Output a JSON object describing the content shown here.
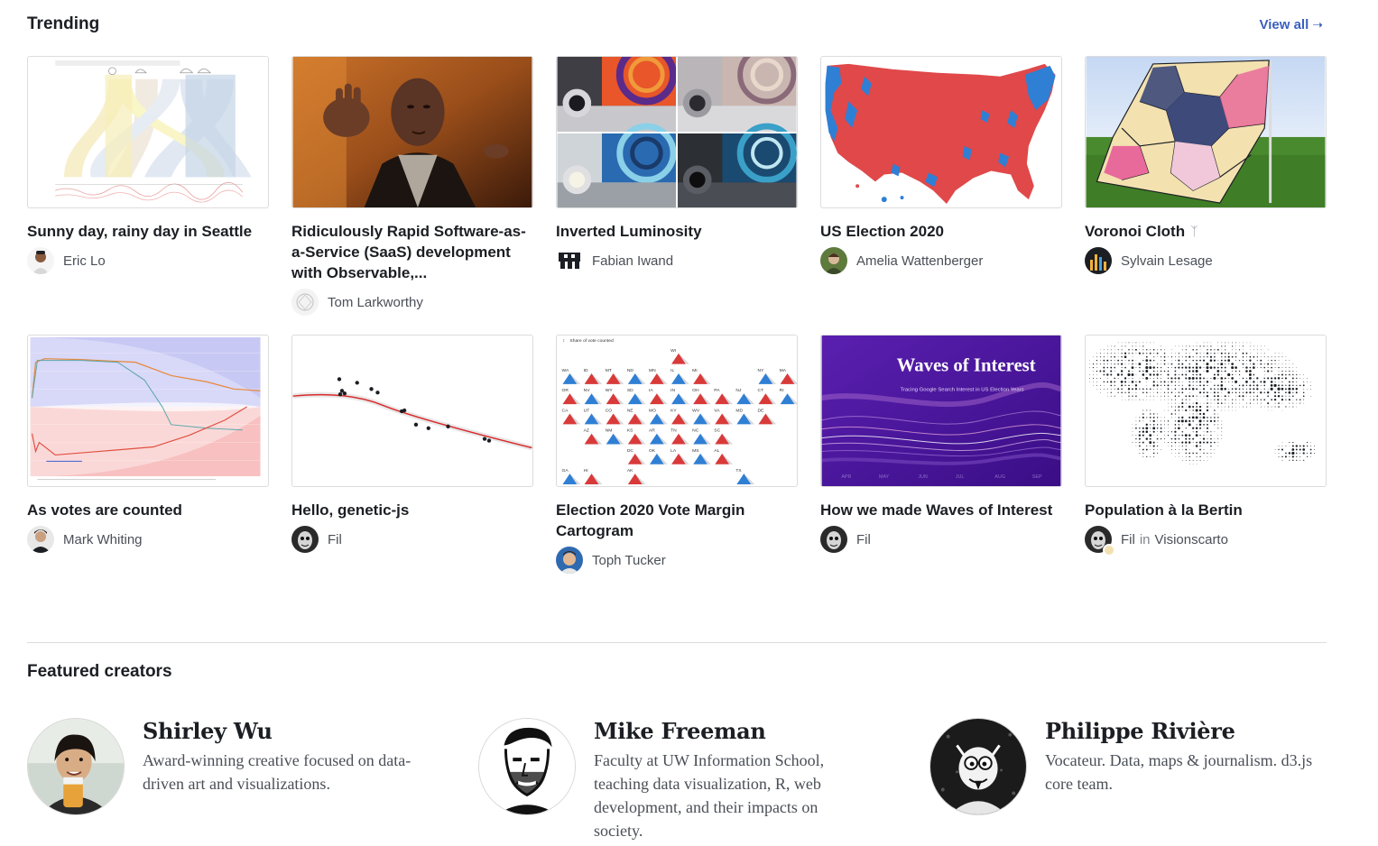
{
  "trending": {
    "title": "Trending",
    "view_all_label": "View all",
    "view_all_icon": "arrow-right-icon",
    "cards": [
      {
        "title": "Sunny day, rainy day in Seattle",
        "author": "Eric Lo",
        "forked": false
      },
      {
        "title": "Ridiculously Rapid Software-as-a-Service (SaaS) development with Observable,...",
        "author": "Tom Larkworthy",
        "forked": false
      },
      {
        "title": "Inverted Luminosity",
        "author": "Fabian Iwand",
        "forked": false
      },
      {
        "title": "US Election 2020",
        "author": "Amelia Wattenberger",
        "forked": false
      },
      {
        "title": "Voronoi Cloth",
        "author": "Sylvain Lesage",
        "forked": true
      },
      {
        "title": "As votes are counted",
        "author": "Mark Whiting",
        "forked": false
      },
      {
        "title": "Hello, genetic-js",
        "author": "Fil",
        "forked": false
      },
      {
        "title": "Election 2020 Vote Margin Cartogram",
        "author": "Toph Tucker",
        "forked": true
      },
      {
        "title": "How we made Waves of Interest",
        "author": "Fil",
        "forked": false
      },
      {
        "title": "Population à la Bertin",
        "author": "Fil",
        "in_label": "in",
        "org": "Visionscarto",
        "forked": false
      }
    ],
    "thumb_text": {
      "waves_title": "Waves of Interest",
      "waves_subtitle": "Tracing Google Search Interest in US Election Years",
      "waves_months": [
        "APR",
        "MAY",
        "JUN",
        "JUL",
        "AUG",
        "SEP"
      ],
      "cartogram_caption": "Share of vote counted",
      "cartogram_states": [
        "WI",
        "VT",
        "NH",
        "WA",
        "ID",
        "MT",
        "ND",
        "MN",
        "IL",
        "MI",
        "NY",
        "MA",
        "OR",
        "NV",
        "WY",
        "SD",
        "IA",
        "IN",
        "OH",
        "PA",
        "NJ",
        "CT",
        "RI",
        "CA",
        "UT",
        "CO",
        "NE",
        "MO",
        "KY",
        "WV",
        "VA",
        "MD",
        "DE",
        "AZ",
        "NM",
        "KS",
        "AR",
        "TN",
        "NC",
        "SC",
        "DC",
        "OK",
        "LA",
        "MS",
        "AL",
        "GA",
        "HI",
        "AK",
        "TX",
        "FL"
      ]
    }
  },
  "featured": {
    "title": "Featured creators",
    "creators": [
      {
        "name": "Shirley Wu",
        "bio": "Award-winning creative focused on data-driven art and visualizations."
      },
      {
        "name": "Mike Freeman",
        "bio": "Faculty at UW Information School, teaching data visualization, R, web development, and their impacts on society."
      },
      {
        "name": "Philippe Rivière",
        "bio": "Vocateur. Data, maps & journalism. d3.js core team."
      }
    ]
  },
  "colors": {
    "accent": "#3b5fc0",
    "republican": "#e0484a",
    "democrat": "#2f7fd4",
    "waves_bg": "#4a1a9e"
  }
}
